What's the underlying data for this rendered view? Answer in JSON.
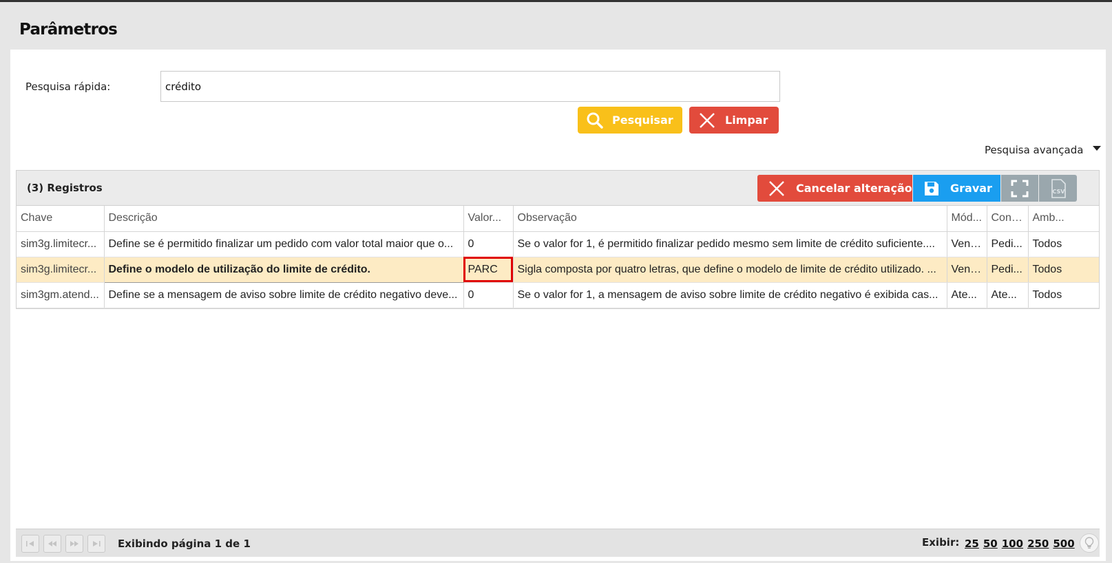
{
  "page": {
    "title": "Parâmetros"
  },
  "search": {
    "label": "Pesquisa rápida:",
    "value": "crédito",
    "search_button": "Pesquisar",
    "clear_button": "Limpar",
    "advanced_label": "Pesquisa avançada"
  },
  "grid": {
    "records_label": "(3) Registros",
    "cancel_button": "Cancelar alteração",
    "save_button": "Gravar",
    "csv_label": "CSV",
    "columns": [
      "Chave",
      "Descrição",
      "Valor...",
      "Observação",
      "Mód...",
      "Cont...",
      "Amb..."
    ],
    "rows": [
      [
        "sim3g.limitecr...",
        "Define se é permitido finalizar um pedido com valor total maior que o...",
        "0",
        "Se o valor for 1, é permitido finalizar pedido mesmo sem limite de crédito suficiente....",
        "Venda",
        "Pedi...",
        "Todos"
      ],
      [
        "sim3g.limitecr...",
        "Define o modelo de utilização do limite de crédito.",
        "PARC",
        "Sigla composta por quatro letras, que define o modelo de limite de crédito utilizado. ...",
        "Venda",
        "Pedi...",
        "Todos"
      ],
      [
        "sim3gm.atend...",
        "Define se a mensagem de aviso sobre limite de crédito negativo deve...",
        "0",
        "Se o valor for 1, a mensagem de aviso sobre limite de crédito negativo é exibida cas...",
        "Ate...",
        "Ate...",
        "Todos"
      ]
    ]
  },
  "pager": {
    "page_info": "Exibindo página 1 de 1",
    "show_label": "Exibir:",
    "sizes": [
      "25",
      "50",
      "100",
      "250",
      "500"
    ]
  },
  "colors": {
    "search_button": "#f9c01a",
    "danger": "#e24b3c",
    "save": "#1a9ef0",
    "selected_row": "#fdebc4",
    "highlight_border": "#e00000"
  },
  "icons": [
    "search-icon",
    "close-icon",
    "save-icon",
    "expand-icon",
    "csv-icon",
    "first-page-icon",
    "prev-page-icon",
    "next-page-icon",
    "last-page-icon",
    "lightbulb-icon"
  ]
}
